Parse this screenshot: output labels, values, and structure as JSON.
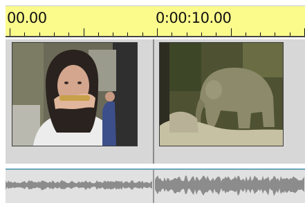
{
  "ruler": {
    "start_label": "00.00",
    "mid_label": "0:00:10.00"
  },
  "video_track": {
    "clips": [
      {
        "icon": "clip-thumbnail-woman-eating"
      },
      {
        "icon": "clip-thumbnail-elephant"
      }
    ]
  },
  "audio_track": {
    "clips": [
      {
        "icon": "waveform-icon"
      },
      {
        "icon": "waveform-icon"
      }
    ]
  },
  "colors": {
    "ruler_bg": "#fbfb8c",
    "track_bg": "#d7d7d7",
    "audio_bg": "#e1e1e1",
    "audio_border": "#6aa6b8",
    "waveform": "#8c8c8c"
  }
}
